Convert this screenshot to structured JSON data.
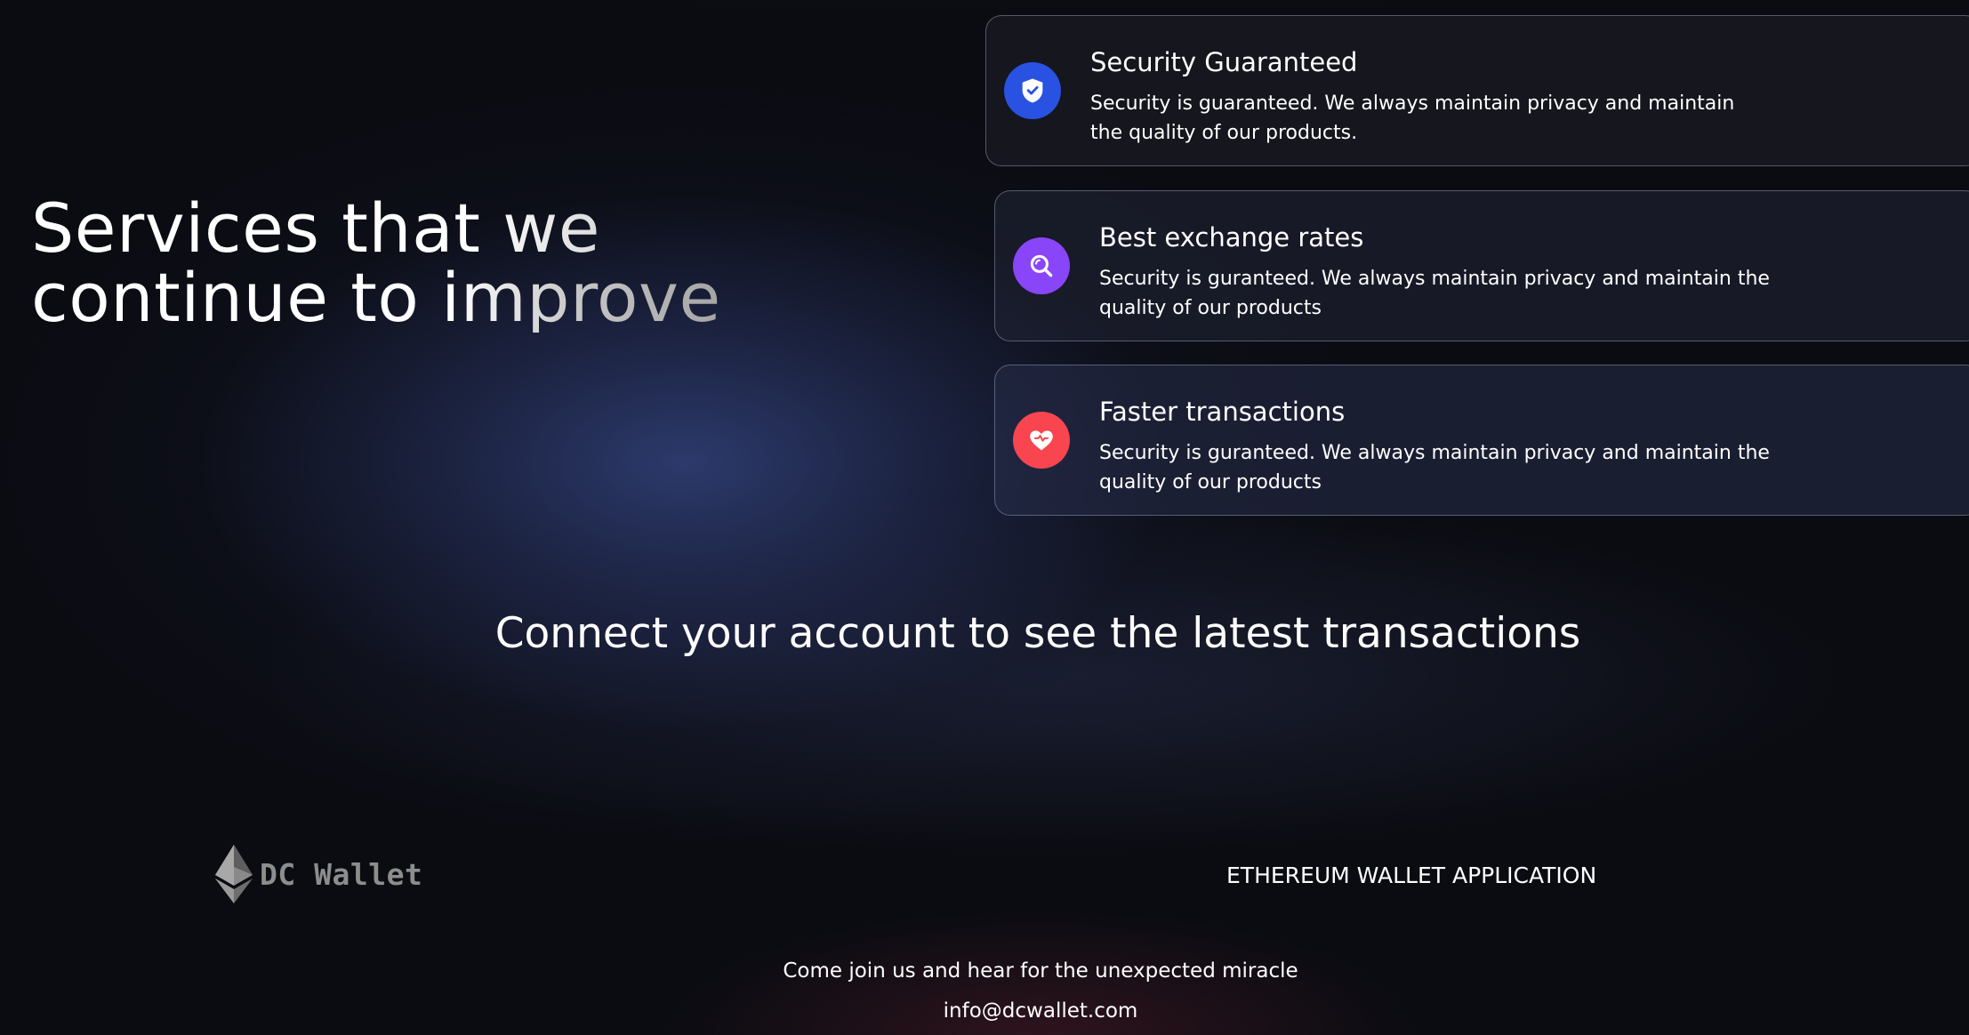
{
  "hero": {
    "title_line1": "Services that we",
    "title_line2": "continue to improve"
  },
  "services": [
    {
      "title": "Security Guaranteed",
      "description": "Security is guaranteed. We always maintain privacy and maintain the quality of our products.",
      "icon": "shield-check-icon",
      "color": "#2952e3"
    },
    {
      "title": "Best exchange rates",
      "description": "Security is guranteed. We always maintain privacy and maintain the quality of our products",
      "icon": "search-icon",
      "color": "#8945f8"
    },
    {
      "title": "Faster transactions",
      "description": "Security is guranteed. We always maintain privacy and maintain the quality of our products",
      "icon": "heart-icon",
      "color": "#f84550"
    }
  ],
  "connect": {
    "title": "Connect your account to see the latest transactions"
  },
  "footer": {
    "logo_text": "DC Wallet",
    "logo_icon": "ethereum-icon",
    "tagline": "ETHEREUM WALLET APPLICATION",
    "join_text": "Come join us and hear for the unexpected miracle",
    "email": "info@dcwallet.com"
  }
}
